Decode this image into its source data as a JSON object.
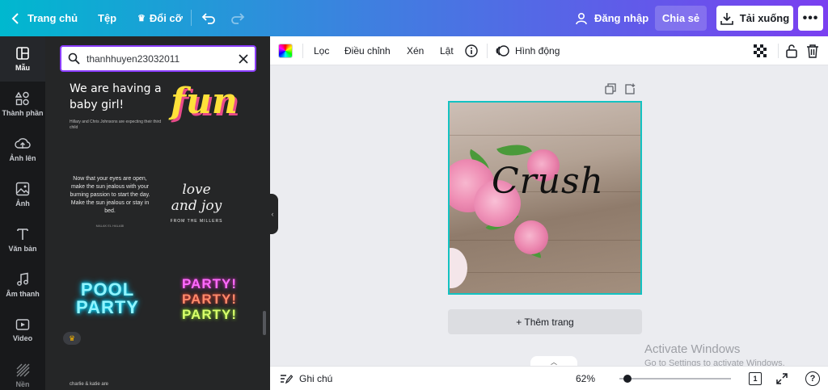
{
  "header": {
    "home_label": "Trang chủ",
    "file_label": "Tệp",
    "resize_label": "Đổi cỡ",
    "login_label": "Đăng nhập",
    "share_label": "Chia sẻ",
    "download_label": "Tải xuống",
    "more_label": "•••"
  },
  "sidebar": {
    "items": [
      {
        "label": "Mẫu",
        "icon": "template-icon"
      },
      {
        "label": "Thành phần",
        "icon": "elements-icon"
      },
      {
        "label": "Ảnh lên",
        "icon": "upload-icon"
      },
      {
        "label": "Ảnh",
        "icon": "photo-icon"
      },
      {
        "label": "Văn bản",
        "icon": "text-icon"
      },
      {
        "label": "Âm thanh",
        "icon": "music-icon"
      },
      {
        "label": "Video",
        "icon": "video-icon"
      },
      {
        "label": "Nền",
        "icon": "background-icon"
      }
    ]
  },
  "panel": {
    "search_value": "thanhhuyen23032011",
    "templates": {
      "baby_big": "We are having a baby girl!",
      "baby_small": "Hillary and Chris Johnsons are expecting their third child",
      "fun": "fun",
      "eyes": "Now that your eyes are open, make the sun jealous with your burning passion to start the day. Make the sun jealous or stay in bed.",
      "eyes_sig": "MALAK EL HALABI",
      "love": "love and joy",
      "love_sub": "FROM THE MILLERS",
      "pool": "POOL PARTY",
      "party": "PARTY!",
      "bottom": "charlie & katie are"
    }
  },
  "toolbar": {
    "filter_label": "Lọc",
    "adjust_label": "Điều chỉnh",
    "crop_label": "Xén",
    "flip_label": "Lật",
    "animate_label": "Hình động"
  },
  "canvas": {
    "design_text": "Crush",
    "add_page_label": "+ Thêm trang"
  },
  "watermark": {
    "line1": "Activate Windows",
    "line2": "Go to Settings to activate Windows."
  },
  "footer": {
    "notes_label": "Ghi chú",
    "zoom": "62%",
    "zoom_fraction": 0.04,
    "page_count": "1",
    "help_label": "?"
  },
  "colors": {
    "accent": "#8b3dff",
    "selection": "#13c2c2",
    "header_start": "#00b8cf",
    "header_end": "#7a3ff0"
  }
}
